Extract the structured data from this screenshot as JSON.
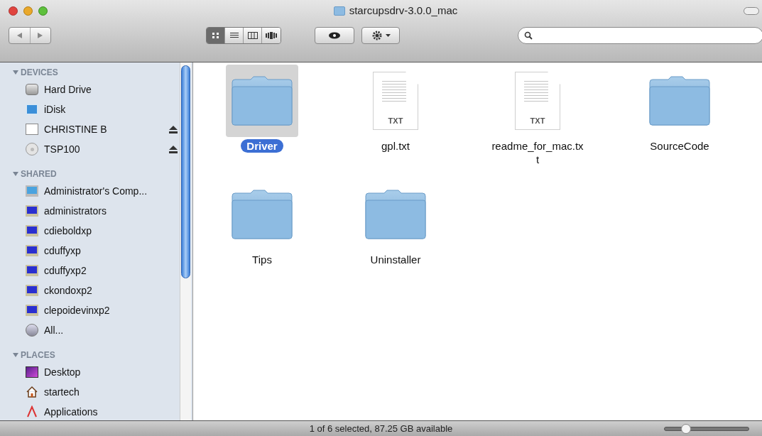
{
  "window": {
    "title": "starcupsdrv-3.0.0_mac"
  },
  "toolbar": {
    "view_modes": [
      {
        "kind": "icons",
        "selected": true
      },
      {
        "kind": "list",
        "selected": false
      },
      {
        "kind": "columns",
        "selected": false
      },
      {
        "kind": "coverflow",
        "selected": false
      }
    ]
  },
  "sidebar": {
    "sections": [
      {
        "title": "DEVICES",
        "expanded": true,
        "items": [
          {
            "label": "Hard Drive",
            "kind": "harddrive",
            "eject": false
          },
          {
            "label": "iDisk",
            "kind": "idisk",
            "eject": false
          },
          {
            "label": "CHRISTINE B",
            "kind": "drive",
            "eject": true
          },
          {
            "label": "TSP100",
            "kind": "disc",
            "eject": true
          }
        ]
      },
      {
        "title": "SHARED",
        "expanded": true,
        "items": [
          {
            "label": "Administrator's Comp...",
            "kind": "mac",
            "eject": false
          },
          {
            "label": "administrators",
            "kind": "pc",
            "eject": false
          },
          {
            "label": "cdieboldxp",
            "kind": "pc",
            "eject": false
          },
          {
            "label": "cduffyxp",
            "kind": "pc",
            "eject": false
          },
          {
            "label": "cduffyxp2",
            "kind": "pc",
            "eject": false
          },
          {
            "label": "ckondoxp2",
            "kind": "pc",
            "eject": false
          },
          {
            "label": "clepoidevinxp2",
            "kind": "pc",
            "eject": false
          },
          {
            "label": "All...",
            "kind": "network",
            "eject": false
          }
        ]
      },
      {
        "title": "PLACES",
        "expanded": true,
        "items": [
          {
            "label": "Desktop",
            "kind": "desktop",
            "eject": false
          },
          {
            "label": "startech",
            "kind": "home",
            "eject": false
          },
          {
            "label": "Applications",
            "kind": "apps",
            "eject": false
          }
        ]
      }
    ]
  },
  "files": [
    {
      "name": "Driver",
      "kind": "folder",
      "selected": true
    },
    {
      "name": "gpl.txt",
      "kind": "text",
      "badge": "TXT",
      "selected": false
    },
    {
      "name": "readme_for_mac.txt",
      "kind": "text",
      "badge": "TXT",
      "selected": false
    },
    {
      "name": "SourceCode",
      "kind": "folder",
      "selected": false
    },
    {
      "name": "Tips",
      "kind": "folder",
      "selected": false
    },
    {
      "name": "Uninstaller",
      "kind": "folder",
      "selected": false
    }
  ],
  "status_bar": {
    "text": "1 of 6 selected, 87.25 GB available",
    "zoom": {
      "level": 0.25
    }
  }
}
